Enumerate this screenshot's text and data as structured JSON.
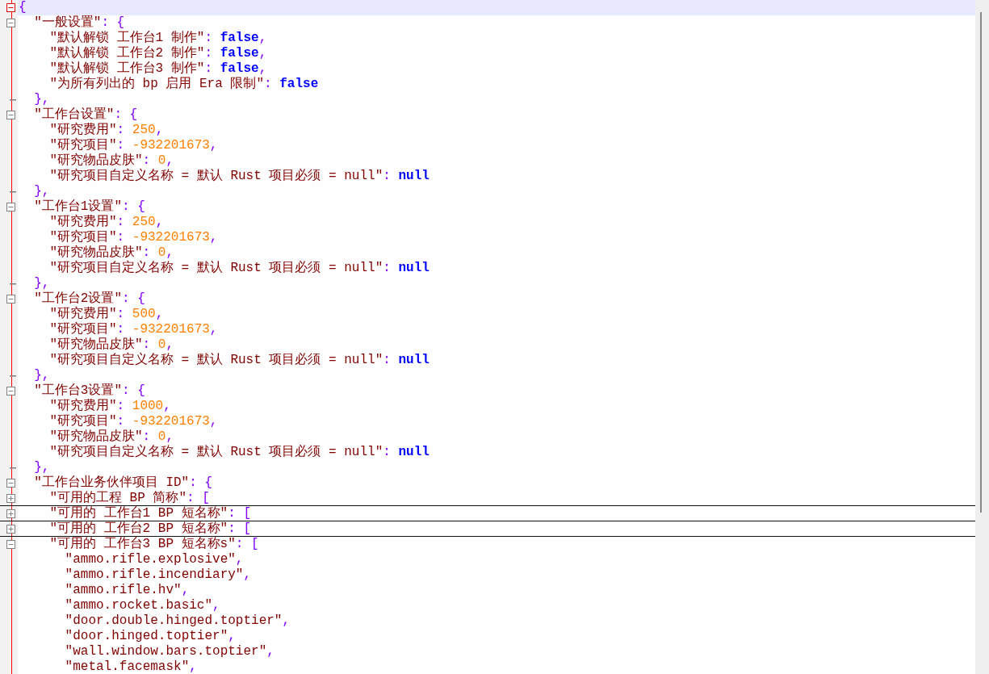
{
  "editor": {
    "lines": [
      {
        "kind": "block",
        "expanded": true,
        "current": true,
        "tokens": [
          {
            "kind": "punct",
            "text": "{"
          }
        ]
      },
      {
        "kind": "block",
        "expanded": true,
        "current": false,
        "tokens": [
          {
            "kind": "key",
            "text": "  \"一般设置\""
          },
          {
            "kind": "punct",
            "text": ": {"
          }
        ]
      },
      {
        "kind": "plain",
        "current": false,
        "tokens": [
          {
            "kind": "key",
            "text": "    \"默认解锁 工作台1 制作\""
          },
          {
            "kind": "punct",
            "text": ": "
          },
          {
            "kind": "keyword",
            "text": "false"
          },
          {
            "kind": "punct",
            "text": ","
          }
        ]
      },
      {
        "kind": "plain",
        "current": false,
        "tokens": [
          {
            "kind": "key",
            "text": "    \"默认解锁 工作台2 制作\""
          },
          {
            "kind": "punct",
            "text": ": "
          },
          {
            "kind": "keyword",
            "text": "false"
          },
          {
            "kind": "punct",
            "text": ","
          }
        ]
      },
      {
        "kind": "plain",
        "current": false,
        "tokens": [
          {
            "kind": "key",
            "text": "    \"默认解锁 工作台3 制作\""
          },
          {
            "kind": "punct",
            "text": ": "
          },
          {
            "kind": "keyword",
            "text": "false"
          },
          {
            "kind": "punct",
            "text": ","
          }
        ]
      },
      {
        "kind": "plain",
        "current": false,
        "tokens": [
          {
            "kind": "key",
            "text": "    \"为所有列出的 bp 启用 Era 限制\""
          },
          {
            "kind": "punct",
            "text": ": "
          },
          {
            "kind": "keyword",
            "text": "false"
          }
        ]
      },
      {
        "kind": "close",
        "current": false,
        "tokens": [
          {
            "kind": "punct",
            "text": "  },"
          }
        ]
      },
      {
        "kind": "block",
        "expanded": true,
        "current": false,
        "tokens": [
          {
            "kind": "key",
            "text": "  \"工作台设置\""
          },
          {
            "kind": "punct",
            "text": ": {"
          }
        ]
      },
      {
        "kind": "plain",
        "current": false,
        "tokens": [
          {
            "kind": "key",
            "text": "    \"研究费用\""
          },
          {
            "kind": "punct",
            "text": ": "
          },
          {
            "kind": "number",
            "text": "250"
          },
          {
            "kind": "punct",
            "text": ","
          }
        ]
      },
      {
        "kind": "plain",
        "current": false,
        "tokens": [
          {
            "kind": "key",
            "text": "    \"研究项目\""
          },
          {
            "kind": "punct",
            "text": ": "
          },
          {
            "kind": "number",
            "text": "-932201673"
          },
          {
            "kind": "punct",
            "text": ","
          }
        ]
      },
      {
        "kind": "plain",
        "current": false,
        "tokens": [
          {
            "kind": "key",
            "text": "    \"研究物品皮肤\""
          },
          {
            "kind": "punct",
            "text": ": "
          },
          {
            "kind": "number",
            "text": "0"
          },
          {
            "kind": "punct",
            "text": ","
          }
        ]
      },
      {
        "kind": "plain",
        "current": false,
        "tokens": [
          {
            "kind": "key",
            "text": "    \"研究项目自定义名称 = 默认 Rust 项目必须 = null\""
          },
          {
            "kind": "punct",
            "text": ": "
          },
          {
            "kind": "keyword",
            "text": "null"
          }
        ]
      },
      {
        "kind": "close",
        "current": false,
        "tokens": [
          {
            "kind": "punct",
            "text": "  },"
          }
        ]
      },
      {
        "kind": "block",
        "expanded": true,
        "current": false,
        "tokens": [
          {
            "kind": "key",
            "text": "  \"工作台1设置\""
          },
          {
            "kind": "punct",
            "text": ": {"
          }
        ]
      },
      {
        "kind": "plain",
        "current": false,
        "tokens": [
          {
            "kind": "key",
            "text": "    \"研究费用\""
          },
          {
            "kind": "punct",
            "text": ": "
          },
          {
            "kind": "number",
            "text": "250"
          },
          {
            "kind": "punct",
            "text": ","
          }
        ]
      },
      {
        "kind": "plain",
        "current": false,
        "tokens": [
          {
            "kind": "key",
            "text": "    \"研究项目\""
          },
          {
            "kind": "punct",
            "text": ": "
          },
          {
            "kind": "number",
            "text": "-932201673"
          },
          {
            "kind": "punct",
            "text": ","
          }
        ]
      },
      {
        "kind": "plain",
        "current": false,
        "tokens": [
          {
            "kind": "key",
            "text": "    \"研究物品皮肤\""
          },
          {
            "kind": "punct",
            "text": ": "
          },
          {
            "kind": "number",
            "text": "0"
          },
          {
            "kind": "punct",
            "text": ","
          }
        ]
      },
      {
        "kind": "plain",
        "current": false,
        "tokens": [
          {
            "kind": "key",
            "text": "    \"研究项目自定义名称 = 默认 Rust 项目必须 = null\""
          },
          {
            "kind": "punct",
            "text": ": "
          },
          {
            "kind": "keyword",
            "text": "null"
          }
        ]
      },
      {
        "kind": "close",
        "current": false,
        "tokens": [
          {
            "kind": "punct",
            "text": "  },"
          }
        ]
      },
      {
        "kind": "block",
        "expanded": true,
        "current": false,
        "tokens": [
          {
            "kind": "key",
            "text": "  \"工作台2设置\""
          },
          {
            "kind": "punct",
            "text": ": {"
          }
        ]
      },
      {
        "kind": "plain",
        "current": false,
        "tokens": [
          {
            "kind": "key",
            "text": "    \"研究费用\""
          },
          {
            "kind": "punct",
            "text": ": "
          },
          {
            "kind": "number",
            "text": "500"
          },
          {
            "kind": "punct",
            "text": ","
          }
        ]
      },
      {
        "kind": "plain",
        "current": false,
        "tokens": [
          {
            "kind": "key",
            "text": "    \"研究项目\""
          },
          {
            "kind": "punct",
            "text": ": "
          },
          {
            "kind": "number",
            "text": "-932201673"
          },
          {
            "kind": "punct",
            "text": ","
          }
        ]
      },
      {
        "kind": "plain",
        "current": false,
        "tokens": [
          {
            "kind": "key",
            "text": "    \"研究物品皮肤\""
          },
          {
            "kind": "punct",
            "text": ": "
          },
          {
            "kind": "number",
            "text": "0"
          },
          {
            "kind": "punct",
            "text": ","
          }
        ]
      },
      {
        "kind": "plain",
        "current": false,
        "tokens": [
          {
            "kind": "key",
            "text": "    \"研究项目自定义名称 = 默认 Rust 项目必须 = null\""
          },
          {
            "kind": "punct",
            "text": ": "
          },
          {
            "kind": "keyword",
            "text": "null"
          }
        ]
      },
      {
        "kind": "close",
        "current": false,
        "tokens": [
          {
            "kind": "punct",
            "text": "  },"
          }
        ]
      },
      {
        "kind": "block",
        "expanded": true,
        "current": false,
        "tokens": [
          {
            "kind": "key",
            "text": "  \"工作台3设置\""
          },
          {
            "kind": "punct",
            "text": ": {"
          }
        ]
      },
      {
        "kind": "plain",
        "current": false,
        "tokens": [
          {
            "kind": "key",
            "text": "    \"研究费用\""
          },
          {
            "kind": "punct",
            "text": ": "
          },
          {
            "kind": "number",
            "text": "1000"
          },
          {
            "kind": "punct",
            "text": ","
          }
        ]
      },
      {
        "kind": "plain",
        "current": false,
        "tokens": [
          {
            "kind": "key",
            "text": "    \"研究项目\""
          },
          {
            "kind": "punct",
            "text": ": "
          },
          {
            "kind": "number",
            "text": "-932201673"
          },
          {
            "kind": "punct",
            "text": ","
          }
        ]
      },
      {
        "kind": "plain",
        "current": false,
        "tokens": [
          {
            "kind": "key",
            "text": "    \"研究物品皮肤\""
          },
          {
            "kind": "punct",
            "text": ": "
          },
          {
            "kind": "number",
            "text": "0"
          },
          {
            "kind": "punct",
            "text": ","
          }
        ]
      },
      {
        "kind": "plain",
        "current": false,
        "tokens": [
          {
            "kind": "key",
            "text": "    \"研究项目自定义名称 = 默认 Rust 项目必须 = null\""
          },
          {
            "kind": "punct",
            "text": ": "
          },
          {
            "kind": "keyword",
            "text": "null"
          }
        ]
      },
      {
        "kind": "close",
        "current": false,
        "tokens": [
          {
            "kind": "punct",
            "text": "  },"
          }
        ]
      },
      {
        "kind": "block",
        "expanded": true,
        "current": false,
        "tokens": [
          {
            "kind": "key",
            "text": "  \"工作台业务伙伴项目 ID\""
          },
          {
            "kind": "punct",
            "text": ": {"
          }
        ]
      },
      {
        "kind": "block",
        "expanded": false,
        "current": false,
        "tokens": [
          {
            "kind": "key",
            "text": "    \"可用的工程 BP 简称\""
          },
          {
            "kind": "punct",
            "text": ": ["
          }
        ]
      },
      {
        "kind": "block",
        "expanded": false,
        "current": false,
        "tokens": [
          {
            "kind": "key",
            "text": "    \"可用的 工作台1 BP 短名称\""
          },
          {
            "kind": "punct",
            "text": ": ["
          }
        ]
      },
      {
        "kind": "block",
        "expanded": false,
        "current": false,
        "tokens": [
          {
            "kind": "key",
            "text": "    \"可用的 工作台2 BP 短名称\""
          },
          {
            "kind": "punct",
            "text": ": ["
          }
        ]
      },
      {
        "kind": "block",
        "expanded": true,
        "current": false,
        "tokens": [
          {
            "kind": "key",
            "text": "    \"可用的 工作台3 BP 短名称s\""
          },
          {
            "kind": "punct",
            "text": ": ["
          }
        ]
      },
      {
        "kind": "plain",
        "current": false,
        "tokens": [
          {
            "kind": "string",
            "text": "      \"ammo.rifle.explosive\""
          },
          {
            "kind": "punct",
            "text": ","
          }
        ]
      },
      {
        "kind": "plain",
        "current": false,
        "tokens": [
          {
            "kind": "string",
            "text": "      \"ammo.rifle.incendiary\""
          },
          {
            "kind": "punct",
            "text": ","
          }
        ]
      },
      {
        "kind": "plain",
        "current": false,
        "tokens": [
          {
            "kind": "string",
            "text": "      \"ammo.rifle.hv\""
          },
          {
            "kind": "punct",
            "text": ","
          }
        ]
      },
      {
        "kind": "plain",
        "current": false,
        "tokens": [
          {
            "kind": "string",
            "text": "      \"ammo.rocket.basic\""
          },
          {
            "kind": "punct",
            "text": ","
          }
        ]
      },
      {
        "kind": "plain",
        "current": false,
        "tokens": [
          {
            "kind": "string",
            "text": "      \"door.double.hinged.toptier\""
          },
          {
            "kind": "punct",
            "text": ","
          }
        ]
      },
      {
        "kind": "plain",
        "current": false,
        "tokens": [
          {
            "kind": "string",
            "text": "      \"door.hinged.toptier\""
          },
          {
            "kind": "punct",
            "text": ","
          }
        ]
      },
      {
        "kind": "plain",
        "current": false,
        "tokens": [
          {
            "kind": "string",
            "text": "      \"wall.window.bars.toptier\""
          },
          {
            "kind": "punct",
            "text": ","
          }
        ]
      },
      {
        "kind": "plain",
        "current": false,
        "tokens": [
          {
            "kind": "string",
            "text": "      \"metal.facemask\""
          },
          {
            "kind": "punct",
            "text": ","
          }
        ]
      }
    ]
  }
}
